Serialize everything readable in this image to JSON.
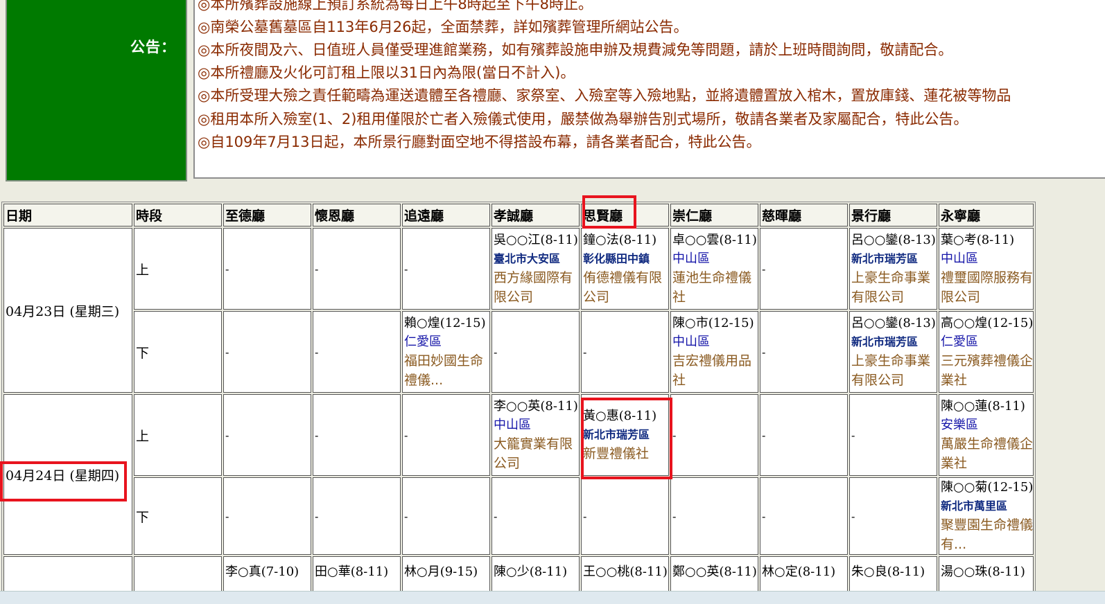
{
  "notice": {
    "label": "公告：",
    "lines": [
      "◎本所殯葬設施線上預訂系統為每日上午8時起至下午8時止。",
      "◎南榮公墓舊墓區自113年6月26起，全面禁葬，詳如殯葬管理所網站公告。",
      "◎本所夜間及六、日值班人員僅受理進館業務，如有殯葬設施申辦及規費減免等問題，請於上班時間詢問，敬請配合。",
      "◎本所禮廳及火化可訂租上限以31日內為限(當日不計入)。",
      "◎本所受理大殮之責任範疇為運送遺體至各禮廳、家祭室、入殮室等入殮地點，並將遺體置放入棺木，置放庫錢、蓮花被等物品",
      "◎租用本所入殮室(1、2)租用僅限於亡者入殮儀式使用，嚴禁做為舉辦告別式場所，敬請各業者及家屬配合，特此公告。",
      "◎自109年7月13日起，本所景行廳對面空地不得搭設布幕，請各業者配合，特此公告。"
    ]
  },
  "table": {
    "headers": [
      "日期",
      "時段",
      "至德廳",
      "懷恩廳",
      "追遠廳",
      "孝誠廳",
      "思賢廳",
      "崇仁廳",
      "慈暉廳",
      "景行廳",
      "永寧廳"
    ],
    "dash": "-",
    "days": [
      {
        "date": "04月23日 (星期三)",
        "periods": [
          {
            "label": "上",
            "cells": [
              null,
              null,
              null,
              {
                "name": "吳○○江(8-11)",
                "area": "臺北市大安區",
                "area_bold": true,
                "company": "西方緣國際有限公司"
              },
              {
                "name": "鐘○法(8-11)",
                "area": "彰化縣田中鎮",
                "area_bold": true,
                "company": "侑德禮儀有限公司"
              },
              {
                "name": "卓○○雲(8-11)",
                "area": "中山區",
                "area_bold": false,
                "company": "蓮池生命禮儀社"
              },
              null,
              {
                "name": "呂○○鑾(8-13)",
                "area": "新北市瑞芳區",
                "area_bold": true,
                "company": "上豪生命事業有限公司"
              },
              {
                "name": "葉○考(8-11)",
                "area": "中山區",
                "area_bold": false,
                "company": "禮璽國際服務有限公司"
              }
            ]
          },
          {
            "label": "下",
            "cells": [
              null,
              null,
              {
                "name": "賴○煌(12-15)",
                "area": "仁愛區",
                "area_bold": false,
                "company": "福田妙國生命禮儀..."
              },
              null,
              null,
              {
                "name": "陳○市(12-15)",
                "area": "中山區",
                "area_bold": false,
                "company": "吉宏禮儀用品社"
              },
              null,
              {
                "name": "呂○○鑾(8-13)",
                "area": "新北市瑞芳區",
                "area_bold": true,
                "company": "上豪生命事業有限公司"
              },
              {
                "name": "高○○煌(12-15)",
                "area": "仁愛區",
                "area_bold": false,
                "company": "三元殯葬禮儀企業社"
              }
            ]
          }
        ]
      },
      {
        "date": "04月24日 (星期四)",
        "periods": [
          {
            "label": "上",
            "cells": [
              null,
              null,
              null,
              {
                "name": "李○○英(8-11)",
                "area": "中山區",
                "area_bold": false,
                "company": "大籠實業有限公司"
              },
              {
                "name": "黃○惠(8-11)",
                "area": "新北市瑞芳區",
                "area_bold": true,
                "company": "新豐禮儀社"
              },
              null,
              null,
              null,
              {
                "name": "陳○○蓮(8-11)",
                "area": "安樂區",
                "area_bold": false,
                "company": "萬嚴生命禮儀企業社"
              }
            ]
          },
          {
            "label": "下",
            "cells": [
              null,
              null,
              null,
              null,
              null,
              null,
              null,
              null,
              {
                "name": "陳○○菊(12-15)",
                "area": "新北市萬里區",
                "area_bold": true,
                "company": "聚豐園生命禮儀有..."
              }
            ]
          }
        ]
      }
    ],
    "partial_row": [
      "",
      "",
      "李○真(7-10)",
      "田○華(8-11)",
      "林○月(9-15)",
      "陳○少(8-11)",
      "王○○桃(8-11)",
      "鄭○○英(8-11)",
      "林○定(8-11)",
      "朱○良(8-11)",
      "湯○○珠(8-11)"
    ]
  },
  "highlight_color": "#e8141e",
  "notice_color": "#007a00"
}
